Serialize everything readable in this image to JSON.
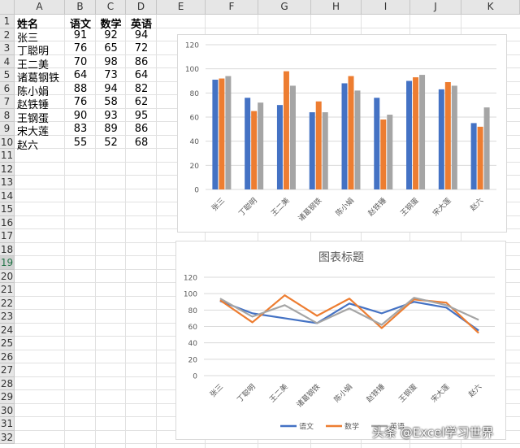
{
  "columns": [
    "A",
    "B",
    "C",
    "D",
    "E",
    "F",
    "G",
    "H",
    "I",
    "J",
    "K"
  ],
  "rows": [
    "1",
    "2",
    "3",
    "4",
    "5",
    "6",
    "7",
    "8",
    "9",
    "10",
    "11",
    "12",
    "13",
    "14",
    "15",
    "16",
    "17",
    "18",
    "19",
    "20",
    "21",
    "22",
    "23",
    "24",
    "25",
    "26",
    "27",
    "28",
    "29",
    "30",
    "31",
    "32"
  ],
  "active_row": "19",
  "table": {
    "headers": [
      "姓名",
      "语文",
      "数学",
      "英语"
    ],
    "rows": [
      [
        "张三",
        "91",
        "92",
        "94"
      ],
      [
        "丁聪明",
        "76",
        "65",
        "72"
      ],
      [
        "王二美",
        "70",
        "98",
        "86"
      ],
      [
        "诸葛钢铁",
        "64",
        "73",
        "64"
      ],
      [
        "陈小娟",
        "88",
        "94",
        "82"
      ],
      [
        "赵铁锤",
        "76",
        "58",
        "62"
      ],
      [
        "王钢蛋",
        "90",
        "93",
        "95"
      ],
      [
        "宋大莲",
        "83",
        "89",
        "86"
      ],
      [
        "赵六",
        "55",
        "52",
        "68"
      ]
    ]
  },
  "colors": {
    "语文": "#4472c4",
    "数学": "#ed7d31",
    "英语": "#a5a5a5"
  },
  "chart_data": [
    {
      "type": "bar",
      "title": "",
      "categories": [
        "张三",
        "丁聪明",
        "王二美",
        "诸葛钢铁",
        "陈小娟",
        "赵铁锤",
        "王钢蛋",
        "宋大莲",
        "赵六"
      ],
      "series": [
        {
          "name": "语文",
          "values": [
            91,
            76,
            70,
            64,
            88,
            76,
            90,
            83,
            55
          ]
        },
        {
          "name": "数学",
          "values": [
            92,
            65,
            98,
            73,
            94,
            58,
            93,
            89,
            52
          ]
        },
        {
          "name": "英语",
          "values": [
            94,
            72,
            86,
            64,
            82,
            62,
            95,
            86,
            68
          ]
        }
      ],
      "ylim": [
        0,
        120
      ],
      "yticks": [
        "0",
        "20",
        "40",
        "60",
        "80",
        "100",
        "120"
      ],
      "grid": true,
      "legend": "none"
    },
    {
      "type": "line",
      "title": "图表标题",
      "categories": [
        "张三",
        "丁聪明",
        "王二美",
        "诸葛钢铁",
        "陈小娟",
        "赵铁锤",
        "王钢蛋",
        "宋大莲",
        "赵六"
      ],
      "series": [
        {
          "name": "语文",
          "values": [
            91,
            76,
            70,
            64,
            88,
            76,
            90,
            83,
            55
          ]
        },
        {
          "name": "数学",
          "values": [
            92,
            65,
            98,
            73,
            94,
            58,
            93,
            89,
            52
          ]
        },
        {
          "name": "英语",
          "values": [
            94,
            72,
            86,
            64,
            82,
            62,
            95,
            86,
            68
          ]
        }
      ],
      "ylim": [
        0,
        120
      ],
      "yticks": [
        "0",
        "20",
        "40",
        "60",
        "80",
        "100",
        "120"
      ],
      "grid": true,
      "legend": "bottom"
    }
  ],
  "watermark": "头条 @Excel学习世界"
}
